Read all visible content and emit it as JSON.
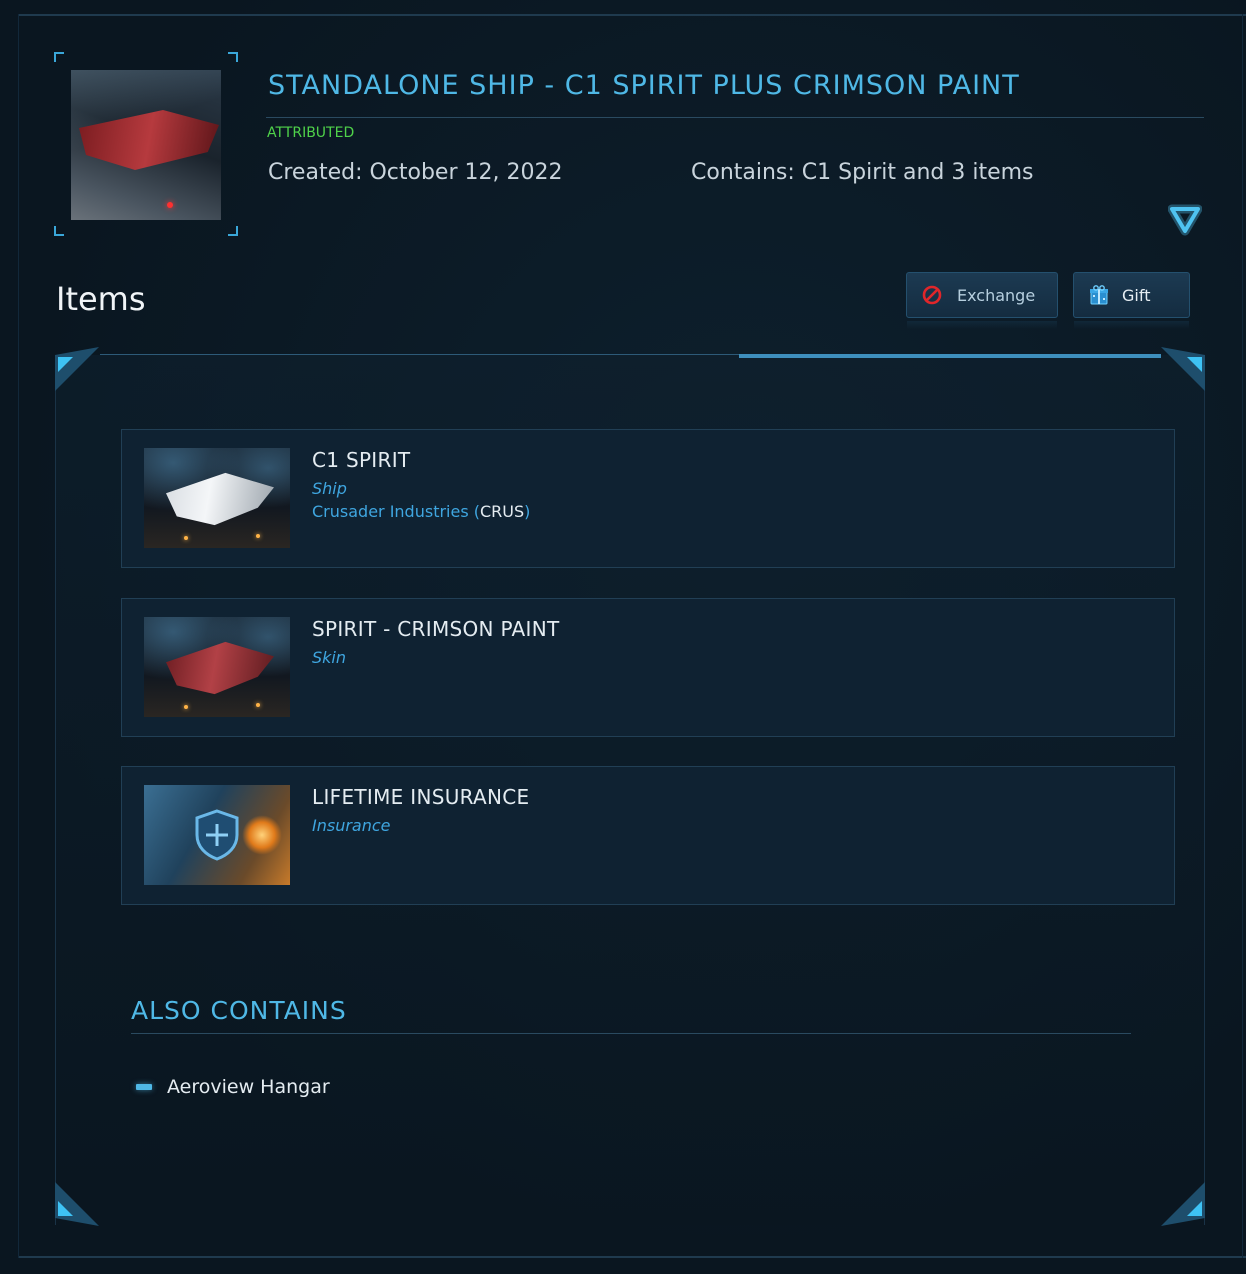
{
  "pledge": {
    "title": "STANDALONE SHIP - C1 SPIRIT PLUS CRIMSON PAINT",
    "status": "ATTRIBUTED",
    "created": "Created: October 12, 2022",
    "contains": "Contains: C1 Spirit and 3 items",
    "expand_icon": "triangle-down-icon"
  },
  "items_section": {
    "heading": "Items",
    "exchange_label": "Exchange",
    "gift_label": "Gift",
    "exchange_icon": "prohibited-icon",
    "gift_icon": "gift-box-icon"
  },
  "items": [
    {
      "name": "C1 SPIRIT",
      "type": "Ship",
      "maker": "Crusader Industries",
      "maker_code": "CRUS"
    },
    {
      "name": "SPIRIT - CRIMSON PAINT",
      "type": "Skin"
    },
    {
      "name": "LIFETIME INSURANCE",
      "type": "Insurance"
    }
  ],
  "also_contains": {
    "heading": "ALSO CONTAINS",
    "items": [
      {
        "label": "Aeroview Hangar"
      }
    ]
  },
  "colors": {
    "accent": "#4fb8e6",
    "status_green": "#4fd24a",
    "background": "#0a1620"
  }
}
